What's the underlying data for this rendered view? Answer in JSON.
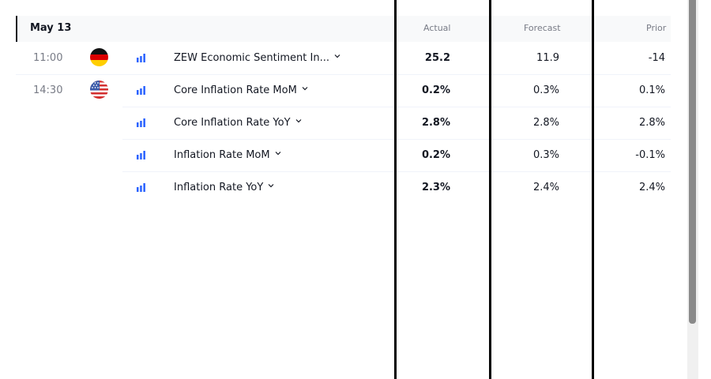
{
  "header": {
    "date": "May 13",
    "col_actual": "Actual",
    "col_forecast": "Forecast",
    "col_prior": "Prior"
  },
  "rows": [
    {
      "time": "11:00",
      "country": "germany-flag",
      "event": "ZEW Economic Sentiment In...",
      "actual": "25.2",
      "forecast": "11.9",
      "prior": "-14"
    },
    {
      "time": "14:30",
      "country": "usa-flag",
      "event": "Core Inflation Rate MoM",
      "actual": "0.2%",
      "forecast": "0.3%",
      "prior": "0.1%"
    },
    {
      "time": "",
      "country": "",
      "event": "Core Inflation Rate YoY",
      "actual": "2.8%",
      "forecast": "2.8%",
      "prior": "2.8%"
    },
    {
      "time": "",
      "country": "",
      "event": "Inflation Rate MoM",
      "actual": "0.2%",
      "forecast": "0.3%",
      "prior": "-0.1%"
    },
    {
      "time": "",
      "country": "",
      "event": "Inflation Rate YoY",
      "actual": "2.3%",
      "forecast": "2.4%",
      "prior": "2.4%"
    }
  ],
  "icons": {
    "importance": "importance-bars-icon",
    "expand": "chevron-down-icon"
  },
  "colors": {
    "importance": "#2962ff",
    "header_bg": "#f8f9fa",
    "muted_text": "#787b86"
  }
}
